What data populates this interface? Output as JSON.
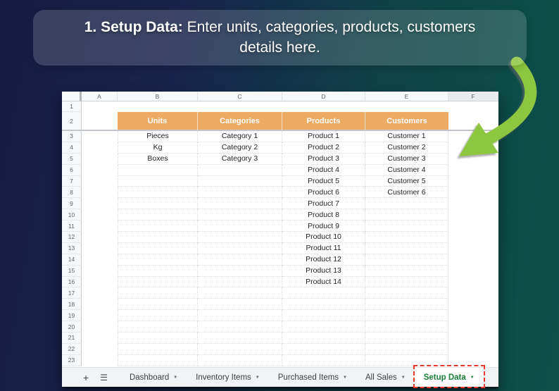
{
  "banner": {
    "bold": "1. Setup Data:",
    "text": " Enter units, categories, products, customers details here."
  },
  "sheet": {
    "column_letters": [
      "A",
      "B",
      "C",
      "D",
      "E",
      "F"
    ],
    "row_count": 23,
    "table_headers": [
      "Units",
      "Categories",
      "Products",
      "Customers"
    ],
    "columns": {
      "units": [
        "Pieces",
        "Kg",
        "Boxes"
      ],
      "categories": [
        "Category 1",
        "Category 2",
        "Category 3"
      ],
      "products": [
        "Product 1",
        "Product 2",
        "Product 3",
        "Product 4",
        "Product 5",
        "Product 6",
        "Product 7",
        "Product 8",
        "Product 9",
        "Product 10",
        "Product 11",
        "Product 12",
        "Product 13",
        "Product 14"
      ],
      "customers": [
        "Customer 1",
        "Customer 2",
        "Customer 3",
        "Customer 4",
        "Customer 5",
        "Customer 6"
      ]
    }
  },
  "tab_bar": {
    "tabs": [
      {
        "label": "Dashboard",
        "active": false,
        "annotated": false
      },
      {
        "label": "Inventory Items",
        "active": false,
        "annotated": false
      },
      {
        "label": "Purchased Items",
        "active": false,
        "annotated": false
      },
      {
        "label": "All Sales",
        "active": false,
        "annotated": false
      },
      {
        "label": "Setup Data",
        "active": true,
        "annotated": true
      }
    ]
  },
  "icons": {
    "plus": "+",
    "sheet_list": "☰",
    "caret": "▼"
  },
  "colors": {
    "header_orange": "#edaa63",
    "arrow_green": "#8dc63f",
    "active_tab_green": "#188038",
    "annotation_red": "#e8392e",
    "bg_navy": "#151c41",
    "bg_teal": "#0d4c48"
  }
}
